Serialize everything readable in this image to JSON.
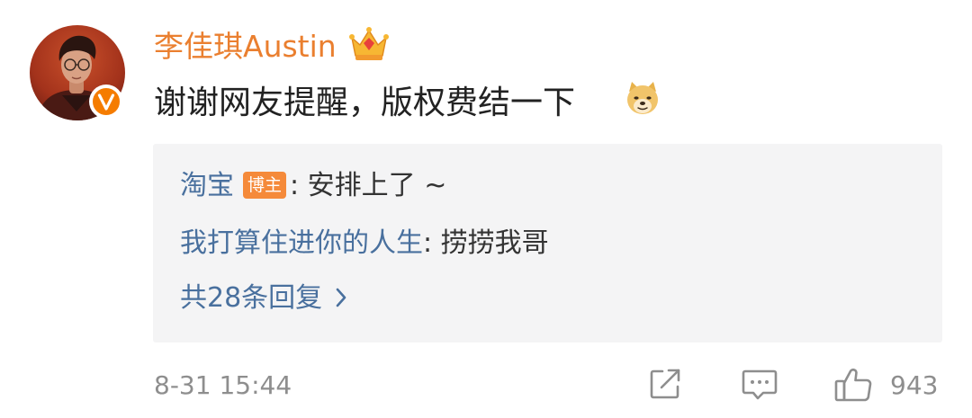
{
  "post": {
    "username": "李佳琪Austin",
    "text": "谢谢网友提醒，版权费结一下",
    "timestamp": "8-31 15:44",
    "like_count": "943"
  },
  "icons": {
    "avatar": "avatar-photo",
    "verified": "verified-v-badge-icon",
    "member": "crown-icon",
    "emoji": "doge-icon",
    "share": "share-icon",
    "comment": "comment-icon",
    "like": "thumbs-up-icon",
    "more_replies": "chevron-right-icon"
  },
  "replies": [
    {
      "author": "淘宝",
      "badge": "博主",
      "text": ": 安排上了 ~"
    },
    {
      "author": "我打算住进你的人生",
      "text": ": 捞捞我哥"
    }
  ],
  "reply_summary": {
    "label": "共28条回复"
  },
  "colors": {
    "username": "#ea7f2f",
    "link": "#49709e",
    "badge": "#f58a3a",
    "verified": "#f57c00",
    "reply_background": "#f4f4f5",
    "meta_text": "#8e8e8e"
  }
}
